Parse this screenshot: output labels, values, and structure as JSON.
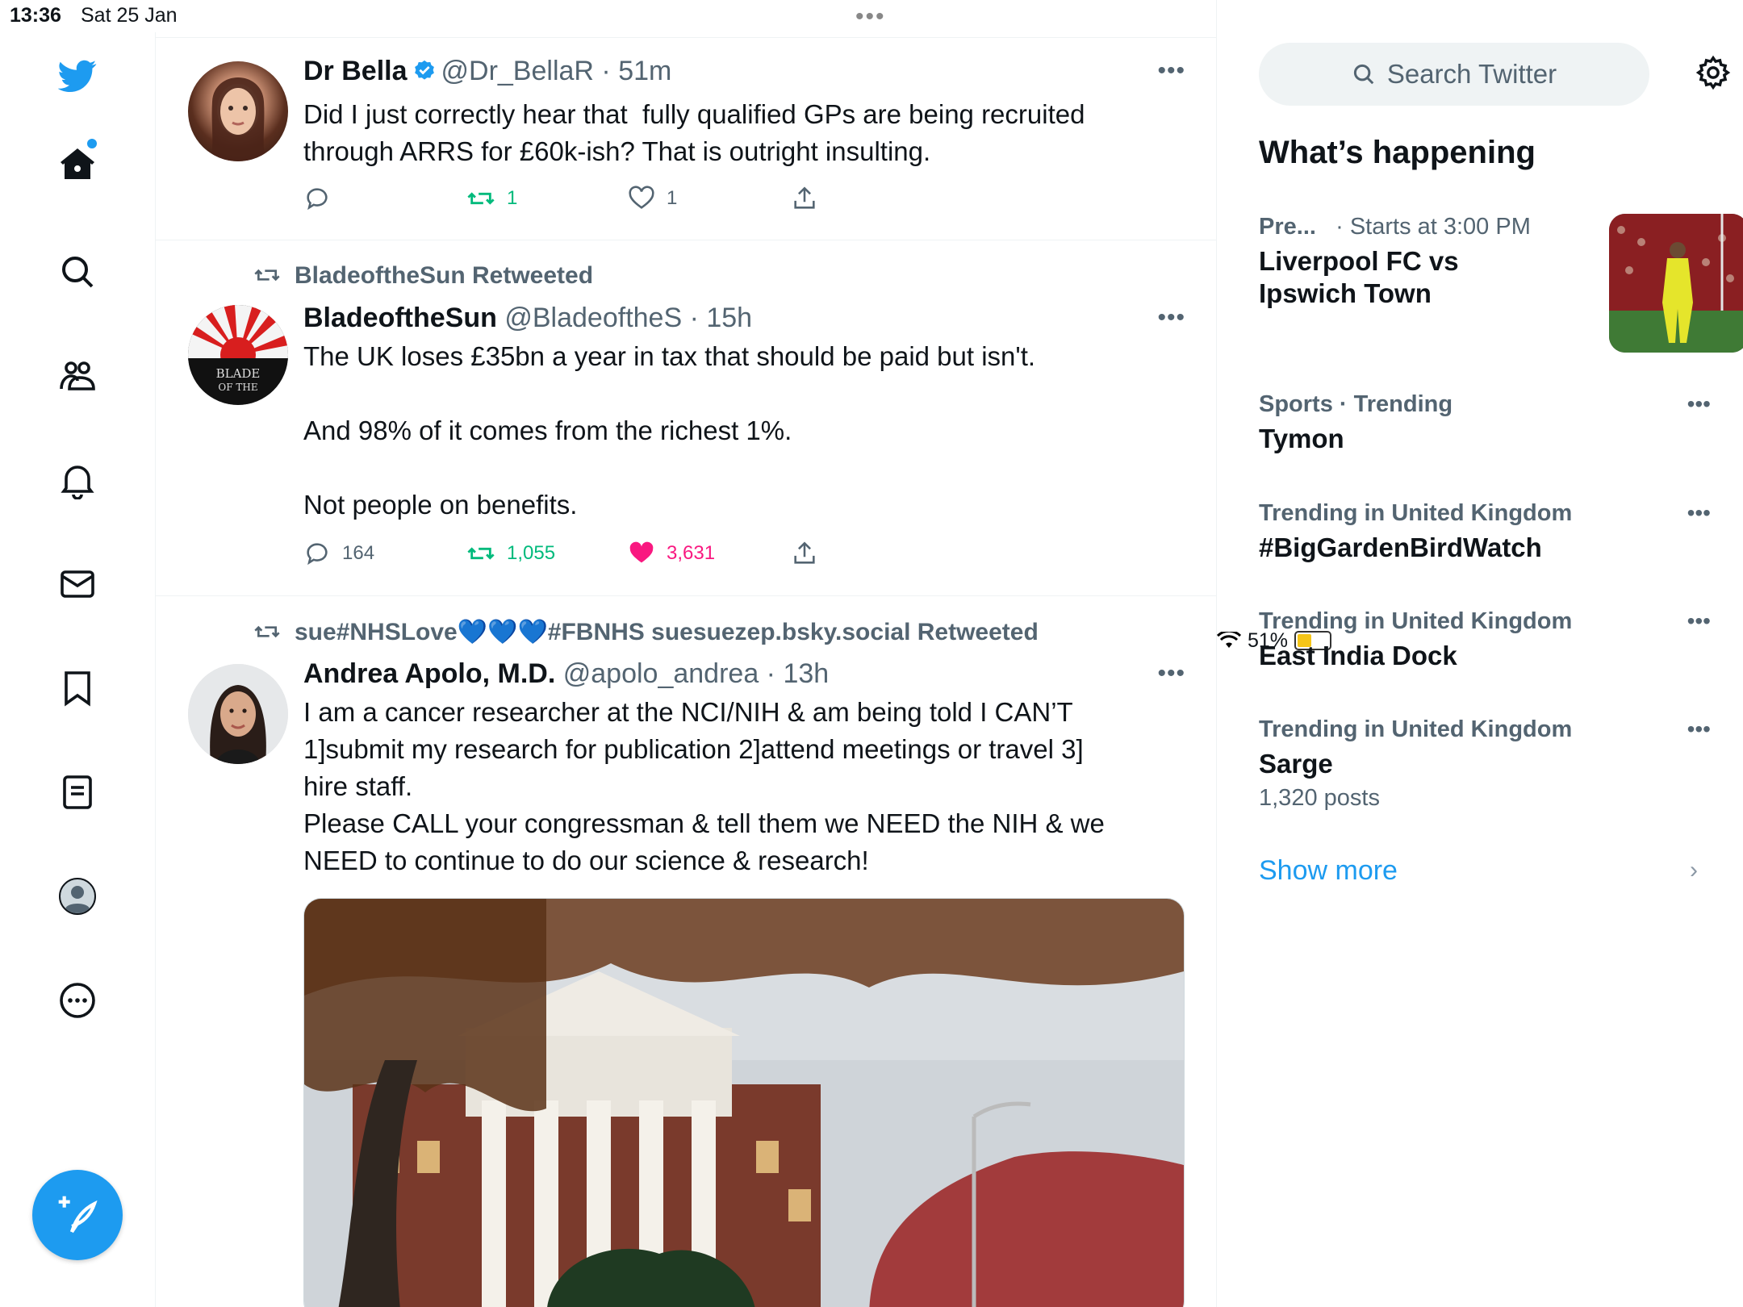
{
  "status_bar": {
    "time": "13:36",
    "date": "Sat 25 Jan",
    "battery": "51%",
    "battery_level": 0.51
  },
  "sidebar": {
    "items": [
      "twitter-logo",
      "home",
      "explore",
      "communities",
      "notifications",
      "messages",
      "bookmarks",
      "lists",
      "profile",
      "more"
    ],
    "compose_label": "Tweet"
  },
  "tweets": [
    {
      "name": "Dr Bella",
      "handle": "@Dr_BellaR",
      "time": "51m",
      "text": "Did I just correctly hear that  fully qualified GPs are being recruited through ARRS for £60k-ish? That is outright insulting.",
      "replies": "",
      "retweets": "1",
      "likes": "1",
      "retweeted_by_me": true,
      "liked_by_me": false
    },
    {
      "context": "BladeoftheSun Retweeted",
      "name": "BladeoftheSun",
      "handle": "@BladeoftheS",
      "time": "15h",
      "text": "The UK loses £35bn a year in tax that should be paid but isn't.\n\nAnd 98% of it comes from the richest 1%.\n\nNot people on benefits.",
      "replies": "164",
      "retweets": "1,055",
      "likes": "3,631",
      "retweeted_by_me": true,
      "liked_by_me": true,
      "avatar_text": "BLADE OF THE"
    },
    {
      "context": "sue#NHSLove💙💙💙#FBNHS suesuezep.bsky.social Retweeted",
      "name": "Andrea Apolo, M.D.",
      "handle": "@apolo_andrea",
      "time": "13h",
      "text": "I am a cancer researcher at the NCI/NIH & am being told I CAN’T 1]submit my research for publication 2]attend meetings or travel 3] hire staff.\nPlease CALL your congressman & tell them we NEED the NIH & we NEED to continue to do our science & research!"
    }
  ],
  "right": {
    "search_placeholder": "Search Twitter",
    "trends_title": "What’s happening",
    "trends": [
      {
        "ctx_a": "Pre...",
        "ctx_b": "· Starts at 3:00 PM",
        "title": "Liverpool FC vs Ipswich Town",
        "has_image": true
      },
      {
        "ctx": "Sports · Trending",
        "title": "Tymon"
      },
      {
        "ctx": "Trending in United Kingdom",
        "title": "#BigGardenBirdWatch"
      },
      {
        "ctx": "Trending in United Kingdom",
        "title": "East India Dock"
      },
      {
        "ctx": "Trending in United Kingdom",
        "title": "Sarge",
        "count": "1,320 posts"
      }
    ],
    "show_more": "Show more"
  },
  "colors": {
    "accent": "#1d9bf0",
    "retweet": "#00ba7c",
    "like": "#f91880",
    "secondary": "#536471"
  }
}
